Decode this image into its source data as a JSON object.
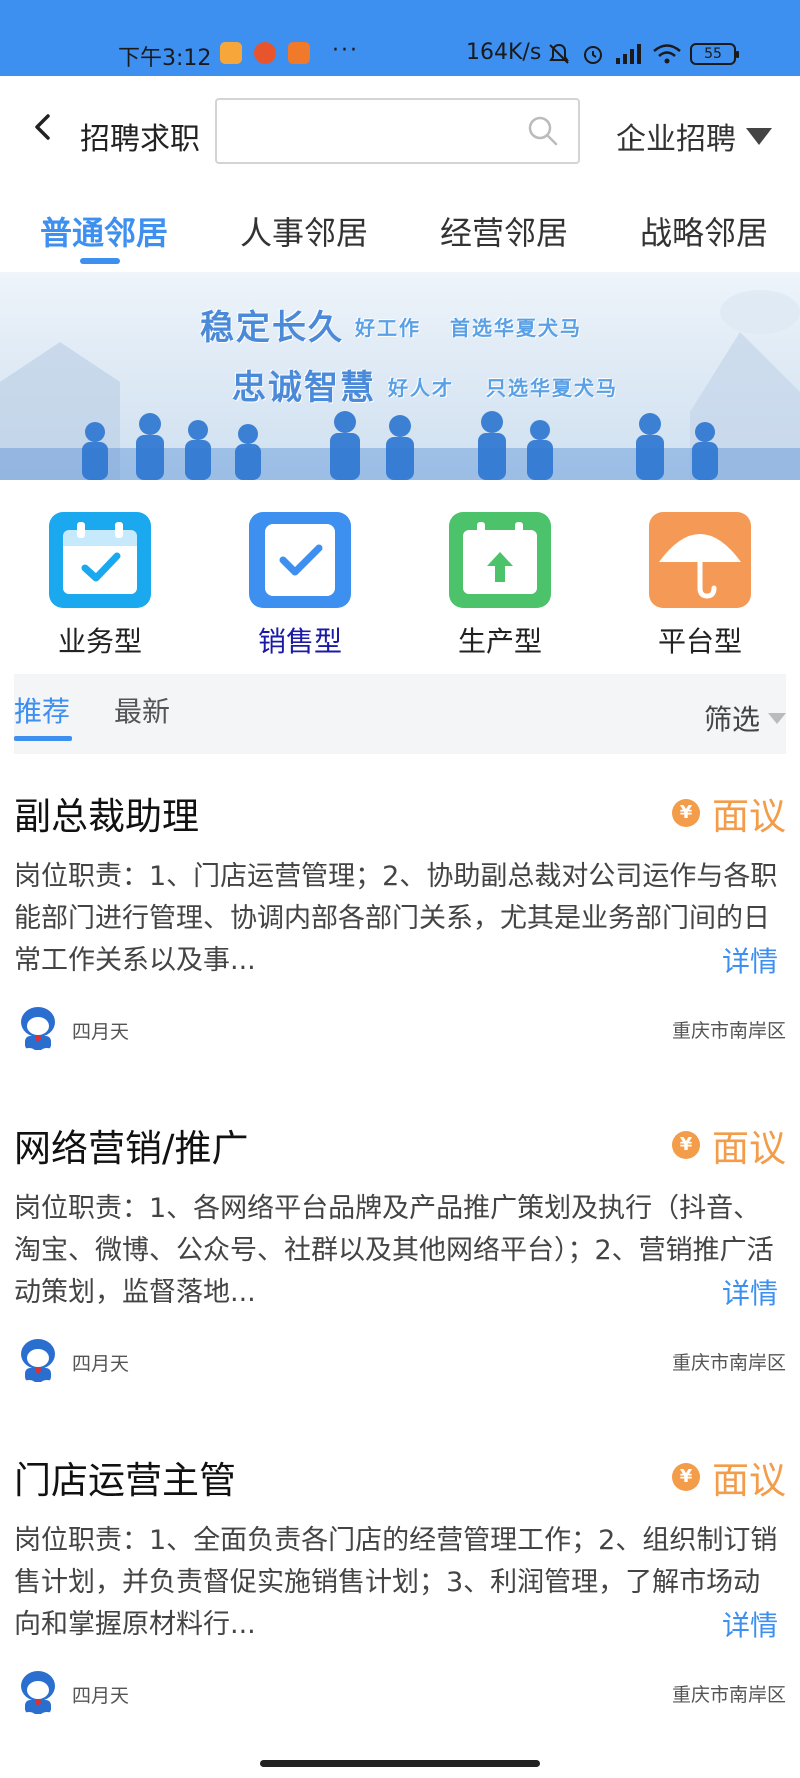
{
  "status_bar": {
    "time": "下午3:12",
    "dots": "···",
    "net_speed": "164K/s",
    "battery": "55",
    "icons": [
      "app-notification-icon",
      "app-notification-icon",
      "hand-icon",
      "mute-bell-icon",
      "alarm-icon",
      "signal-icon",
      "wifi-icon",
      "battery-icon"
    ]
  },
  "header": {
    "title": "招聘求职",
    "search_placeholder": "",
    "search_value": "",
    "company_filter": "企业招聘"
  },
  "category_tabs": [
    {
      "label": "普通邻居",
      "active": true
    },
    {
      "label": "人事邻居",
      "active": false
    },
    {
      "label": "经营邻居",
      "active": false
    },
    {
      "label": "战略邻居",
      "active": false
    }
  ],
  "banner": {
    "line1": "稳定长久",
    "line1_a": "好工作",
    "line1_b": "首选华夏犬马",
    "line2": "忠诚智慧",
    "line2_a": "好人才",
    "line2_b": "只选华夏犬马"
  },
  "job_types": [
    {
      "label": "业务型",
      "icon": "calendar-check-icon",
      "color": "#1aa8ee",
      "selected": false
    },
    {
      "label": "销售型",
      "icon": "checkbox-icon",
      "color": "#3d8ff0",
      "selected": true
    },
    {
      "label": "生产型",
      "icon": "calendar-upload-icon",
      "color": "#4cc36a",
      "selected": false
    },
    {
      "label": "平台型",
      "icon": "umbrella-icon",
      "color": "#f59a56",
      "selected": false
    }
  ],
  "sort": {
    "tabs": [
      {
        "label": "推荐",
        "active": true
      },
      {
        "label": "最新",
        "active": false
      }
    ],
    "filter_label": "筛选"
  },
  "jobs": [
    {
      "title": "副总裁助理",
      "salary": "面议",
      "description": "岗位职责：1、门店运营管理；2、协助副总裁对公司运作与各职能部门进行管理、协调内部各部门关系，尤其是业务部门间的日常工作关系以及事...",
      "detail_label": "详情",
      "poster": "四月天",
      "location": "重庆市南岸区"
    },
    {
      "title": "网络营销/推广",
      "salary": "面议",
      "description": "岗位职责：1、各网络平台品牌及产品推广策划及执行（抖音、淘宝、微博、公众号、社群以及其他网络平台）；2、营销推广活动策划，监督落地...",
      "detail_label": "详情",
      "poster": "四月天",
      "location": "重庆市南岸区"
    },
    {
      "title": "门店运营主管",
      "salary": "面议",
      "description": "岗位职责：1、全面负责各门店的经营管理工作；2、组织制订销售计划，并负责督促实施销售计划；3、利润管理，了解市场动向和掌握原材料行...",
      "detail_label": "详情",
      "poster": "四月天",
      "location": "重庆市南岸区"
    }
  ],
  "colors": {
    "accent": "#3d8ff0",
    "salary": "#f39c4a",
    "status_bar": "#3d8ff0"
  }
}
